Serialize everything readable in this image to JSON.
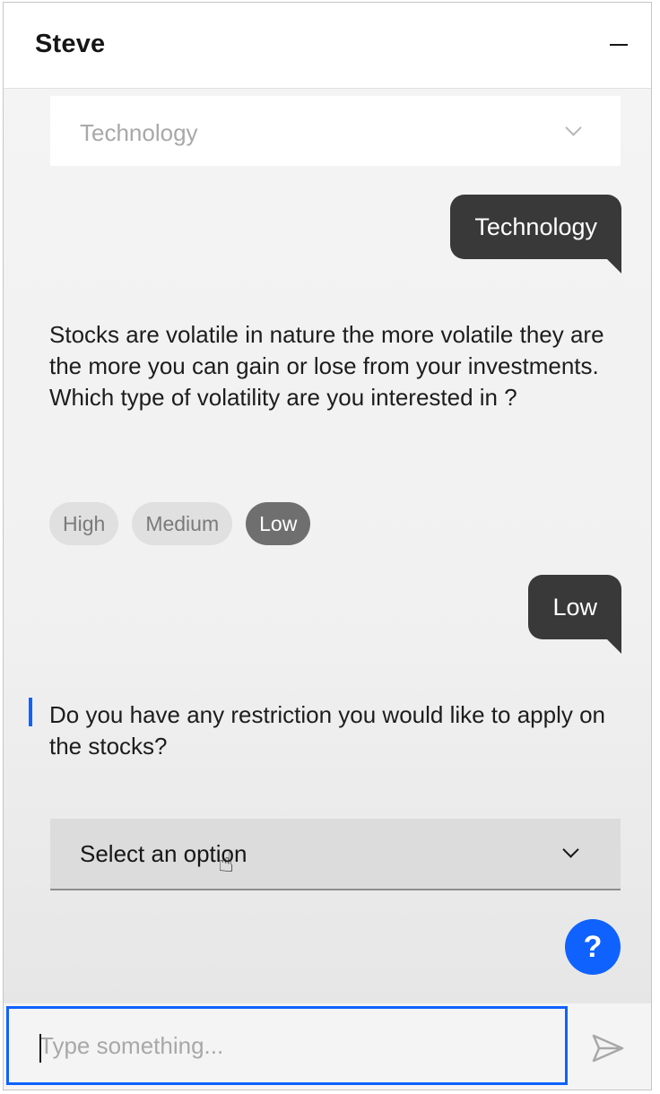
{
  "header": {
    "title": "Steve"
  },
  "conversation": {
    "previous_dropdown_value": "Technology",
    "user_reply_1": "Technology",
    "bot_message_1": "Stocks are volatile in nature the more volatile they are the more you can gain or lose from your investments.\nWhich type of volatility are you interested in ?",
    "options": [
      {
        "label": "High",
        "selected": false
      },
      {
        "label": "Medium",
        "selected": false
      },
      {
        "label": "Low",
        "selected": true
      }
    ],
    "user_reply_2": "Low",
    "bot_message_2": "Do you have any restriction you would like to apply on the stocks?",
    "select_placeholder": "Select an option"
  },
  "help_button": {
    "label": "?"
  },
  "input": {
    "placeholder": "Type something..."
  },
  "colors": {
    "accent": "#0f62fe",
    "user_bubble": "#393939",
    "chip_selected": "#6f6f6f"
  }
}
